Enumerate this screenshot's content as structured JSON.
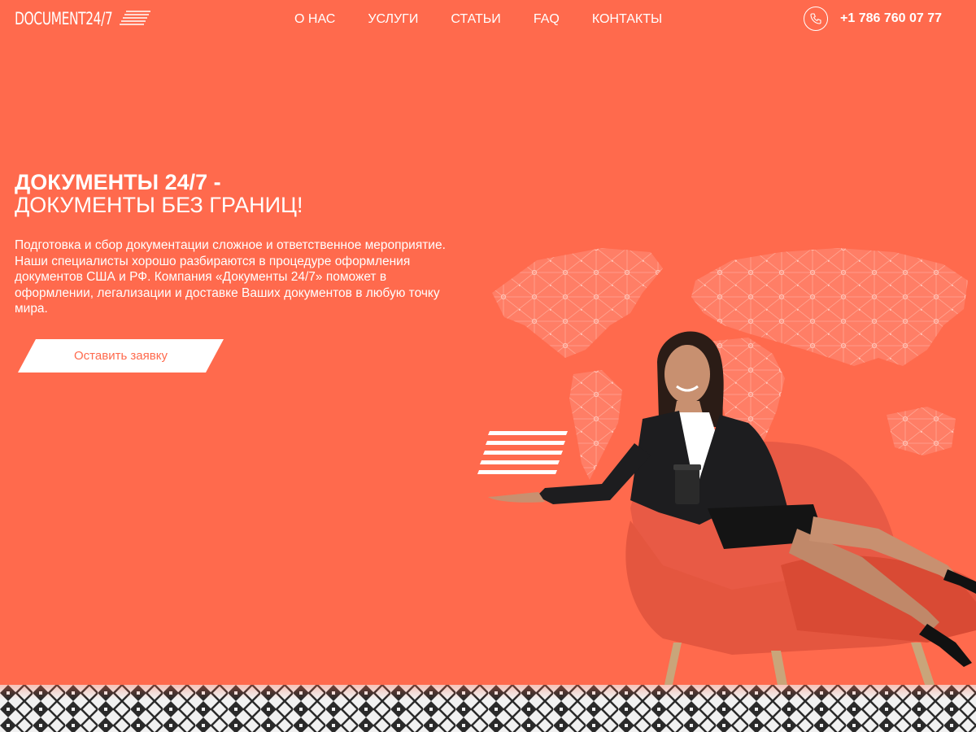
{
  "brand": {
    "logo_text": "DOCUMENT24/7",
    "accent_color": "#ff6a4d",
    "text_color": "#ffffff"
  },
  "nav": {
    "items": [
      "О НАС",
      "УСЛУГИ",
      "СТАТЬИ",
      "FAQ",
      "КОНТАКТЫ"
    ]
  },
  "contact": {
    "phone_icon": "phone-icon",
    "phone": "+1 786 760 07 77"
  },
  "hero": {
    "title_line1": "ДОКУМЕНТЫ 24/7 -",
    "title_line2": "ДОКУМЕНТЫ БЕЗ ГРАНИЦ!",
    "description": "Подготовка и сбор документации сложное и ответственное мероприятие. Наши специалисты хорошо разбираются в процедуре оформления документов США и РФ. Компания «Документы 24/7» поможет в оформлении, легализации и доставке Ваших документов в любую точку мира.",
    "cta_label": "Оставить заявку"
  },
  "decor": {
    "map": "world-map-network",
    "person": "businesswoman-in-armchair",
    "floor": "geometric-rug-pattern"
  }
}
